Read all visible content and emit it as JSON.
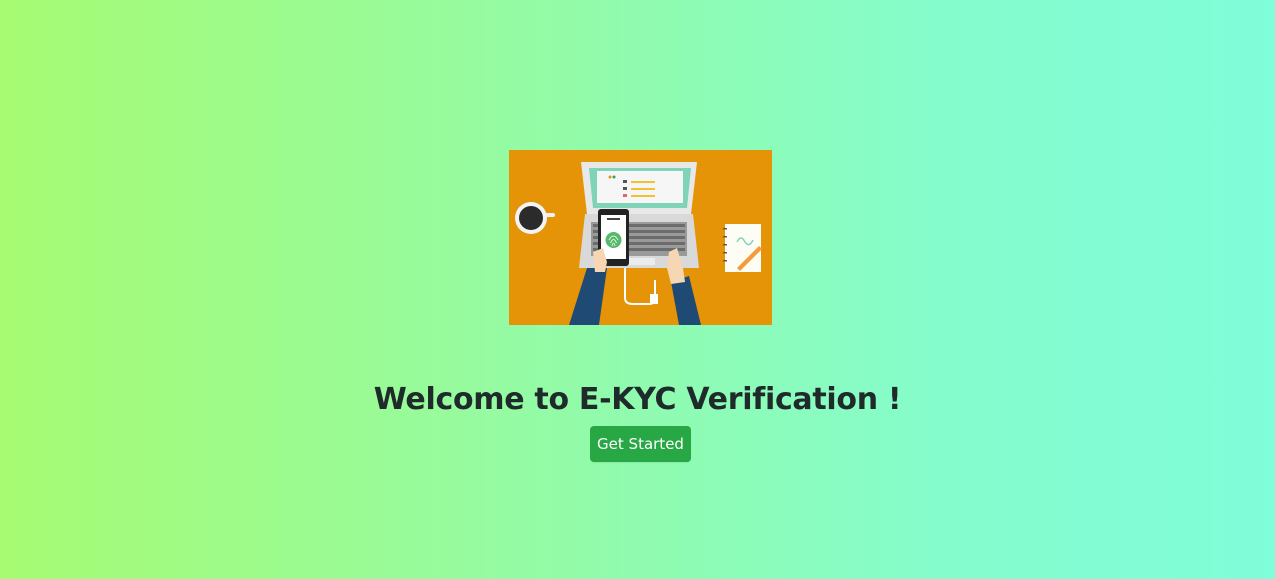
{
  "page": {
    "title": "Welcome to E-KYC Verification !"
  },
  "hero": {
    "image_icon": "laptop-phone-fingerprint-illustration",
    "colors": {
      "background": "#e59408",
      "screen": "#7fd3b6",
      "laptop": "#d9d9d9",
      "sleeve": "#1f4a74"
    }
  },
  "cta": {
    "label": "Get Started",
    "color": "#28a745"
  },
  "colors": {
    "gradient_start": "#a6fb72",
    "gradient_end": "#80fdd9",
    "title_text": "#1f2a2a"
  }
}
